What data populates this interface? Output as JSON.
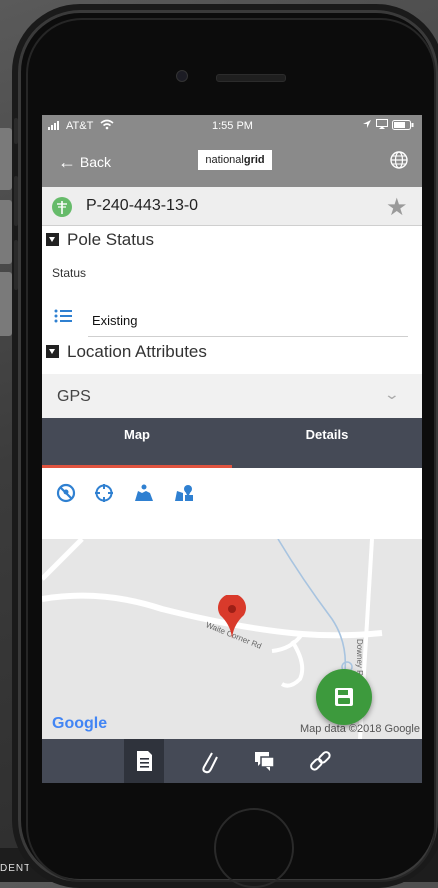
{
  "status_bar": {
    "carrier": "AT&T",
    "time": "1:55 PM"
  },
  "nav": {
    "back_label": "Back",
    "logo_prefix": "national",
    "logo_suffix": "grid"
  },
  "record": {
    "title": "P-240-443-13-0"
  },
  "pole_status": {
    "section_label": "Pole  Status",
    "field_label": "Status",
    "field_value": "Existing"
  },
  "location": {
    "section_label": "Location  Attributes"
  },
  "gps": {
    "label": "GPS"
  },
  "tabs": [
    {
      "label": "Map",
      "active": true
    },
    {
      "label": "Details",
      "active": false
    }
  ],
  "map": {
    "road_1": "Waite Corner Rd",
    "road_2": "Downey Rd",
    "provider": "Google",
    "attribution": "Map data ©2018 Google"
  },
  "map_tools": [
    "pin-off-icon",
    "crosshair-icon",
    "map-person-icon",
    "map-layers-icon"
  ],
  "bottom_bar": [
    "document-icon",
    "paperclip-icon",
    "comments-icon",
    "link-icon"
  ],
  "background": {
    "footer_text": "DENT"
  },
  "colors": {
    "accent_red": "#e0533f",
    "nav_gray": "#8a8a8a",
    "tab_dark": "#454a56",
    "fab_green": "#3d9a3d",
    "icon_blue": "#2f80d1"
  }
}
